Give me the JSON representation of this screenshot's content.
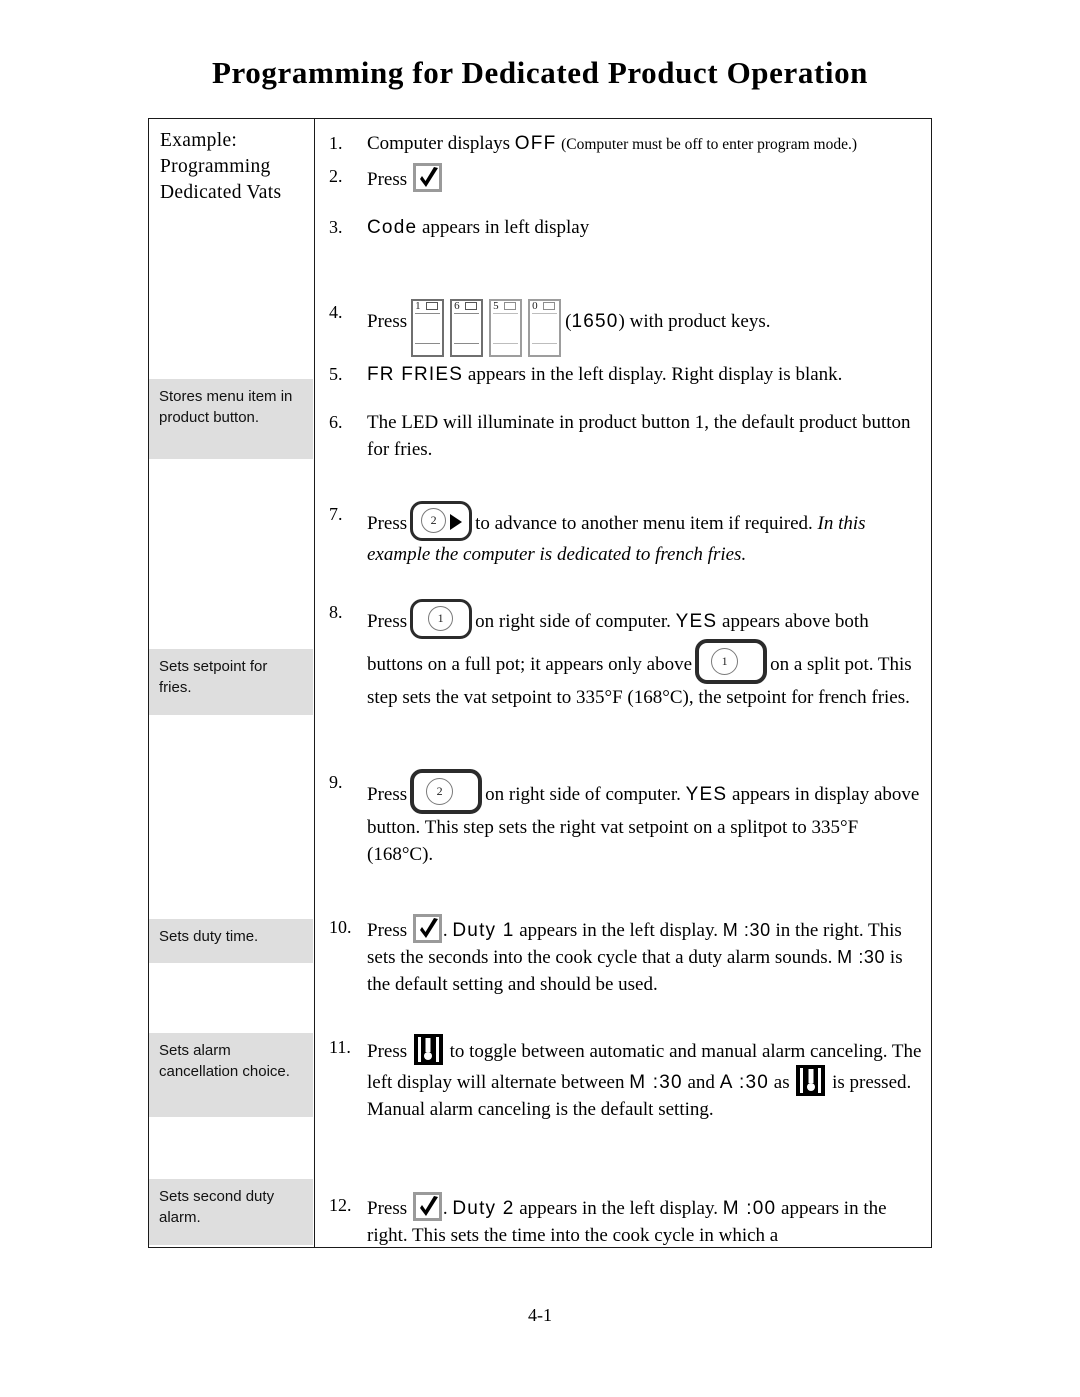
{
  "document": {
    "title": "Programming for Dedicated Product Operation",
    "page_number": "4-1"
  },
  "left_column": {
    "heading": "Example: Programming Dedicated Vats",
    "notes": [
      {
        "text": "Stores menu item in product button."
      },
      {
        "text": "Sets setpoint for fries."
      },
      {
        "text": "Sets duty time."
      },
      {
        "text": "Sets alarm cancellation choice."
      },
      {
        "text": "Sets second duty alarm."
      }
    ]
  },
  "steps": {
    "s1": {
      "num": "1.",
      "text_a": "Computer displays",
      "display": "OFF",
      "paren": "(Computer must be off to enter program mode.)"
    },
    "s2": {
      "num": "2.",
      "text_a": "Press",
      "icon": "checkmark-button-icon"
    },
    "s3": {
      "num": "3.",
      "display": "Code",
      "text_a": "appears in left display"
    },
    "s4": {
      "num": "4.",
      "text_a": "Press",
      "keys": [
        {
          "label": "1",
          "style": "dark"
        },
        {
          "label": "6",
          "style": "dark"
        },
        {
          "label": "5",
          "style": "light"
        },
        {
          "label": "0",
          "style": "light"
        }
      ],
      "code_open": "(",
      "code": "1650",
      "code_close": ")",
      "text_b": "with product keys."
    },
    "s5": {
      "num": "5.",
      "display": "FR FRIES",
      "text_a": "appears in the left display. Right display is blank."
    },
    "s6": {
      "num": "6.",
      "text_a": "The LED will illuminate in product button 1, the default product button for fries."
    },
    "s7": {
      "num": "7.",
      "text_a": "Press",
      "button": "2",
      "text_b": "to advance to another menu item if required.",
      "italic": "In this example the computer is dedicated to french fries."
    },
    "s8": {
      "num": "8.",
      "text_a": "Press",
      "button_1": "1",
      "text_b": "on right side of computer.",
      "display": "YES",
      "text_c": "appears above both buttons on a full pot; it appears  only above",
      "button_2": "1",
      "text_d": "on a split pot. This step sets the vat setpoint to 335°F (168°C), the setpoint for french fries."
    },
    "s9": {
      "num": "9.",
      "text_a": "Press",
      "button": "2",
      "text_b": "on right side of computer.",
      "display": "YES",
      "text_c": "appears in display above button. This step sets the right vat setpoint on a splitpot to 335°F (168°C)."
    },
    "s10": {
      "num": "10.",
      "text_a": "Press",
      "icon": "checkmark-button-icon",
      "text_b": ".",
      "display_a": "Duty 1",
      "text_c": "appears in the left display.",
      "display_b": "M :30",
      "text_d": "in the right. This sets the seconds into the cook cycle that a duty alarm sounds.",
      "display_c": "M :30",
      "text_e": "is the default setting and should be used."
    },
    "s11": {
      "num": "11.",
      "text_a": "Press",
      "icon": "alarm-toggle-icon",
      "text_b": "to toggle between automatic and manual alarm canceling. The left display will alternate between",
      "display_a": "M :30",
      "text_c": "and",
      "display_b": "A :30",
      "text_d": "as",
      "text_e": "is pressed. Manual alarm canceling is the default setting."
    },
    "s12": {
      "num": "12.",
      "text_a": "Press",
      "icon": "checkmark-button-icon",
      "text_b": ".",
      "display_a": "Duty 2",
      "text_c": "appears in the left display.",
      "display_b": "M :00",
      "text_d": "appears in the right. This sets the time into the cook cycle in which a"
    }
  },
  "colors": {
    "note_background": "#dedede",
    "border": "#1a1a1a",
    "icon_gray": "#9a9a9a"
  }
}
